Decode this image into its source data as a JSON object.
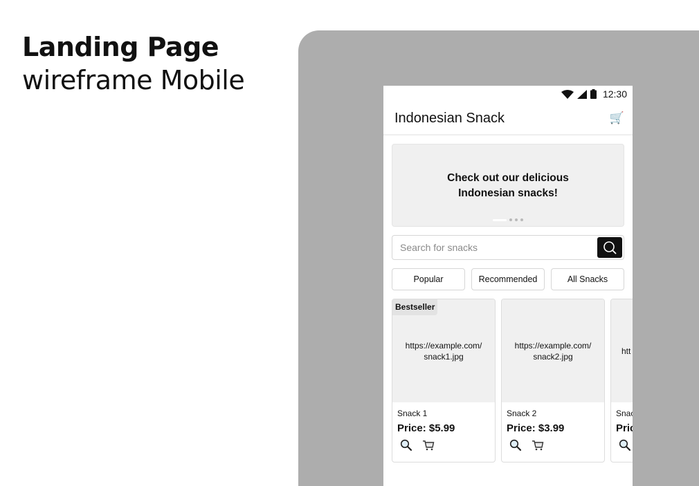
{
  "heading": {
    "title": "Landing Page",
    "subtitle": "wireframe Mobile"
  },
  "status_bar": {
    "time": "12:30",
    "icons": [
      "wifi-icon",
      "signal-icon",
      "battery-icon"
    ]
  },
  "app_bar": {
    "title": "Indonesian Snack",
    "cart_icon": "cart-icon"
  },
  "banner": {
    "text": "Check out our delicious Indonesian snacks!",
    "slide_count": 4,
    "active_slide": 1
  },
  "search": {
    "placeholder": "Search for snacks",
    "value": "",
    "button_icon": "search-icon"
  },
  "tabs": [
    "Popular",
    "Recommended",
    "All Snacks"
  ],
  "products": [
    {
      "badge": "Bestseller",
      "image": "https://example.com/ snack1.jpg",
      "name": "Snack 1",
      "price": "Price: $5.99"
    },
    {
      "badge": "",
      "image": "https://example.com/ snack2.jpg",
      "name": "Snack 2",
      "price": "Price: $3.99"
    },
    {
      "badge": "",
      "image": "htt",
      "name": "Snac",
      "price": "Pric"
    }
  ],
  "colors": {
    "backdrop": "#adadad",
    "banner_bg": "#f0f0f0",
    "search_button": "#111111",
    "text": "#111111"
  }
}
